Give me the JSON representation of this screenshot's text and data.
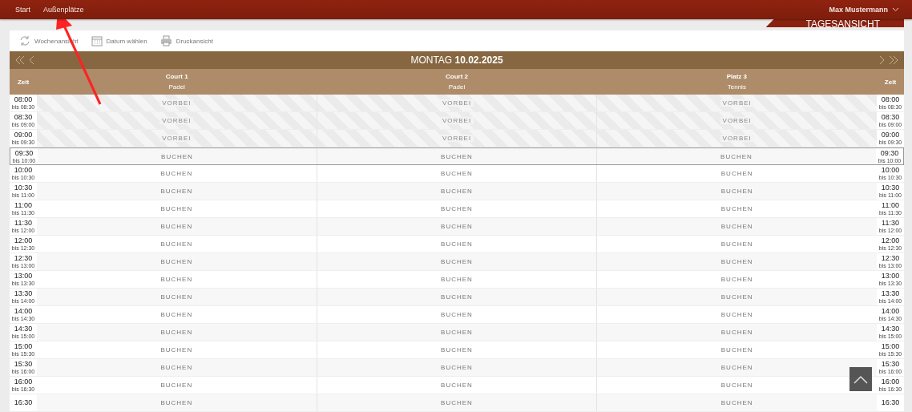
{
  "nav": {
    "items": [
      {
        "label": "Start"
      },
      {
        "label": "Außenplätze"
      }
    ],
    "user": "Max Mustermann"
  },
  "banner": {
    "title": "TAGESANSICHT"
  },
  "toolbar": [
    {
      "kind": "week",
      "label": "Wochenansicht"
    },
    {
      "kind": "date",
      "label": "Datum wählen"
    },
    {
      "kind": "print",
      "label": "Druckansicht"
    }
  ],
  "day": {
    "weekday": "MONTAG",
    "date": "10.02.2025"
  },
  "columns": {
    "time_left": "Zeit",
    "time_right": "Zeit",
    "courts": [
      {
        "name": "Court 1",
        "sport": "Padel"
      },
      {
        "name": "Court 2",
        "sport": "Padel"
      },
      {
        "name": "Platz 3",
        "sport": "Tennis"
      }
    ]
  },
  "rows": [
    {
      "left": {
        "time": "08:00",
        "until": "bis 08:30"
      },
      "right": {
        "time": "08:00",
        "until": "bis 08:30"
      },
      "kind": "past",
      "current": false,
      "slots": [
        "VORBEI",
        "VORBEI",
        "VORBEI"
      ]
    },
    {
      "left": {
        "time": "08:30",
        "until": "bis 09:00"
      },
      "right": {
        "time": "08:30",
        "until": "bis 09:00"
      },
      "kind": "past",
      "current": false,
      "slots": [
        "VORBEI",
        "VORBEI",
        "VORBEI"
      ]
    },
    {
      "left": {
        "time": "09:00",
        "until": "bis 09:30"
      },
      "right": {
        "time": "09:00",
        "until": "bis 09:30"
      },
      "kind": "past",
      "current": false,
      "slots": [
        "VORBEI",
        "VORBEI",
        "VORBEI"
      ]
    },
    {
      "left": {
        "time": "09:30",
        "until": "bis 10:00"
      },
      "right": {
        "time": "09:30",
        "until": "bis 10:00"
      },
      "kind": "free",
      "current": true,
      "slots": [
        "BUCHEN",
        "BUCHEN",
        "BUCHEN"
      ]
    },
    {
      "left": {
        "time": "10:00",
        "until": "bis 10:30"
      },
      "right": {
        "time": "10:00",
        "until": "bis 10:30"
      },
      "kind": "free",
      "current": false,
      "slots": [
        "BUCHEN",
        "BUCHEN",
        "BUCHEN"
      ]
    },
    {
      "left": {
        "time": "10:30",
        "until": "bis 11:00"
      },
      "right": {
        "time": "10:30",
        "until": "bis 11:00"
      },
      "kind": "free",
      "current": false,
      "slots": [
        "BUCHEN",
        "BUCHEN",
        "BUCHEN"
      ]
    },
    {
      "left": {
        "time": "11:00",
        "until": "bis 11:30"
      },
      "right": {
        "time": "11:00",
        "until": "bis 11:30"
      },
      "kind": "free",
      "current": false,
      "slots": [
        "BUCHEN",
        "BUCHEN",
        "BUCHEN"
      ]
    },
    {
      "left": {
        "time": "11:30",
        "until": "bis 12:00"
      },
      "right": {
        "time": "11:30",
        "until": "bis 12:00"
      },
      "kind": "free",
      "current": false,
      "slots": [
        "BUCHEN",
        "BUCHEN",
        "BUCHEN"
      ]
    },
    {
      "left": {
        "time": "12:00",
        "until": "bis 12:30"
      },
      "right": {
        "time": "12:00",
        "until": "bis 12:30"
      },
      "kind": "free",
      "current": false,
      "slots": [
        "BUCHEN",
        "BUCHEN",
        "BUCHEN"
      ]
    },
    {
      "left": {
        "time": "12:30",
        "until": "bis 13:00"
      },
      "right": {
        "time": "12:30",
        "until": "bis 13:00"
      },
      "kind": "free",
      "current": false,
      "slots": [
        "BUCHEN",
        "BUCHEN",
        "BUCHEN"
      ]
    },
    {
      "left": {
        "time": "13:00",
        "until": "bis 13:30"
      },
      "right": {
        "time": "13:00",
        "until": "bis 13:30"
      },
      "kind": "free",
      "current": false,
      "slots": [
        "BUCHEN",
        "BUCHEN",
        "BUCHEN"
      ]
    },
    {
      "left": {
        "time": "13:30",
        "until": "bis 14:00"
      },
      "right": {
        "time": "13:30",
        "until": "bis 14:00"
      },
      "kind": "free",
      "current": false,
      "slots": [
        "BUCHEN",
        "BUCHEN",
        "BUCHEN"
      ]
    },
    {
      "left": {
        "time": "14:00",
        "until": "bis 14:30"
      },
      "right": {
        "time": "14:00",
        "until": "bis 14:30"
      },
      "kind": "free",
      "current": false,
      "slots": [
        "BUCHEN",
        "BUCHEN",
        "BUCHEN"
      ]
    },
    {
      "left": {
        "time": "14:30",
        "until": "bis 15:00"
      },
      "right": {
        "time": "14:30",
        "until": "bis 15:00"
      },
      "kind": "free",
      "current": false,
      "slots": [
        "BUCHEN",
        "BUCHEN",
        "BUCHEN"
      ]
    },
    {
      "left": {
        "time": "15:00",
        "until": "bis 15:30"
      },
      "right": {
        "time": "15:00",
        "until": "bis 15:30"
      },
      "kind": "free",
      "current": false,
      "slots": [
        "BUCHEN",
        "BUCHEN",
        "BUCHEN"
      ]
    },
    {
      "left": {
        "time": "15:30",
        "until": "bis 16:00"
      },
      "right": {
        "time": "15:30",
        "until": "bis 16:00"
      },
      "kind": "free",
      "current": false,
      "slots": [
        "BUCHEN",
        "BUCHEN",
        "BUCHEN"
      ]
    },
    {
      "left": {
        "time": "16:00",
        "until": "bis 16:30"
      },
      "right": {
        "time": "16:00",
        "until": "bis 16:30"
      },
      "kind": "free",
      "current": false,
      "slots": [
        "BUCHEN",
        "BUCHEN",
        "BUCHEN"
      ]
    },
    {
      "left": {
        "time": "16:30"
      },
      "right": {
        "time": "16:30"
      },
      "kind": "free",
      "current": false,
      "slots": [
        "BUCHEN",
        "BUCHEN",
        "BUCHEN"
      ]
    }
  ]
}
